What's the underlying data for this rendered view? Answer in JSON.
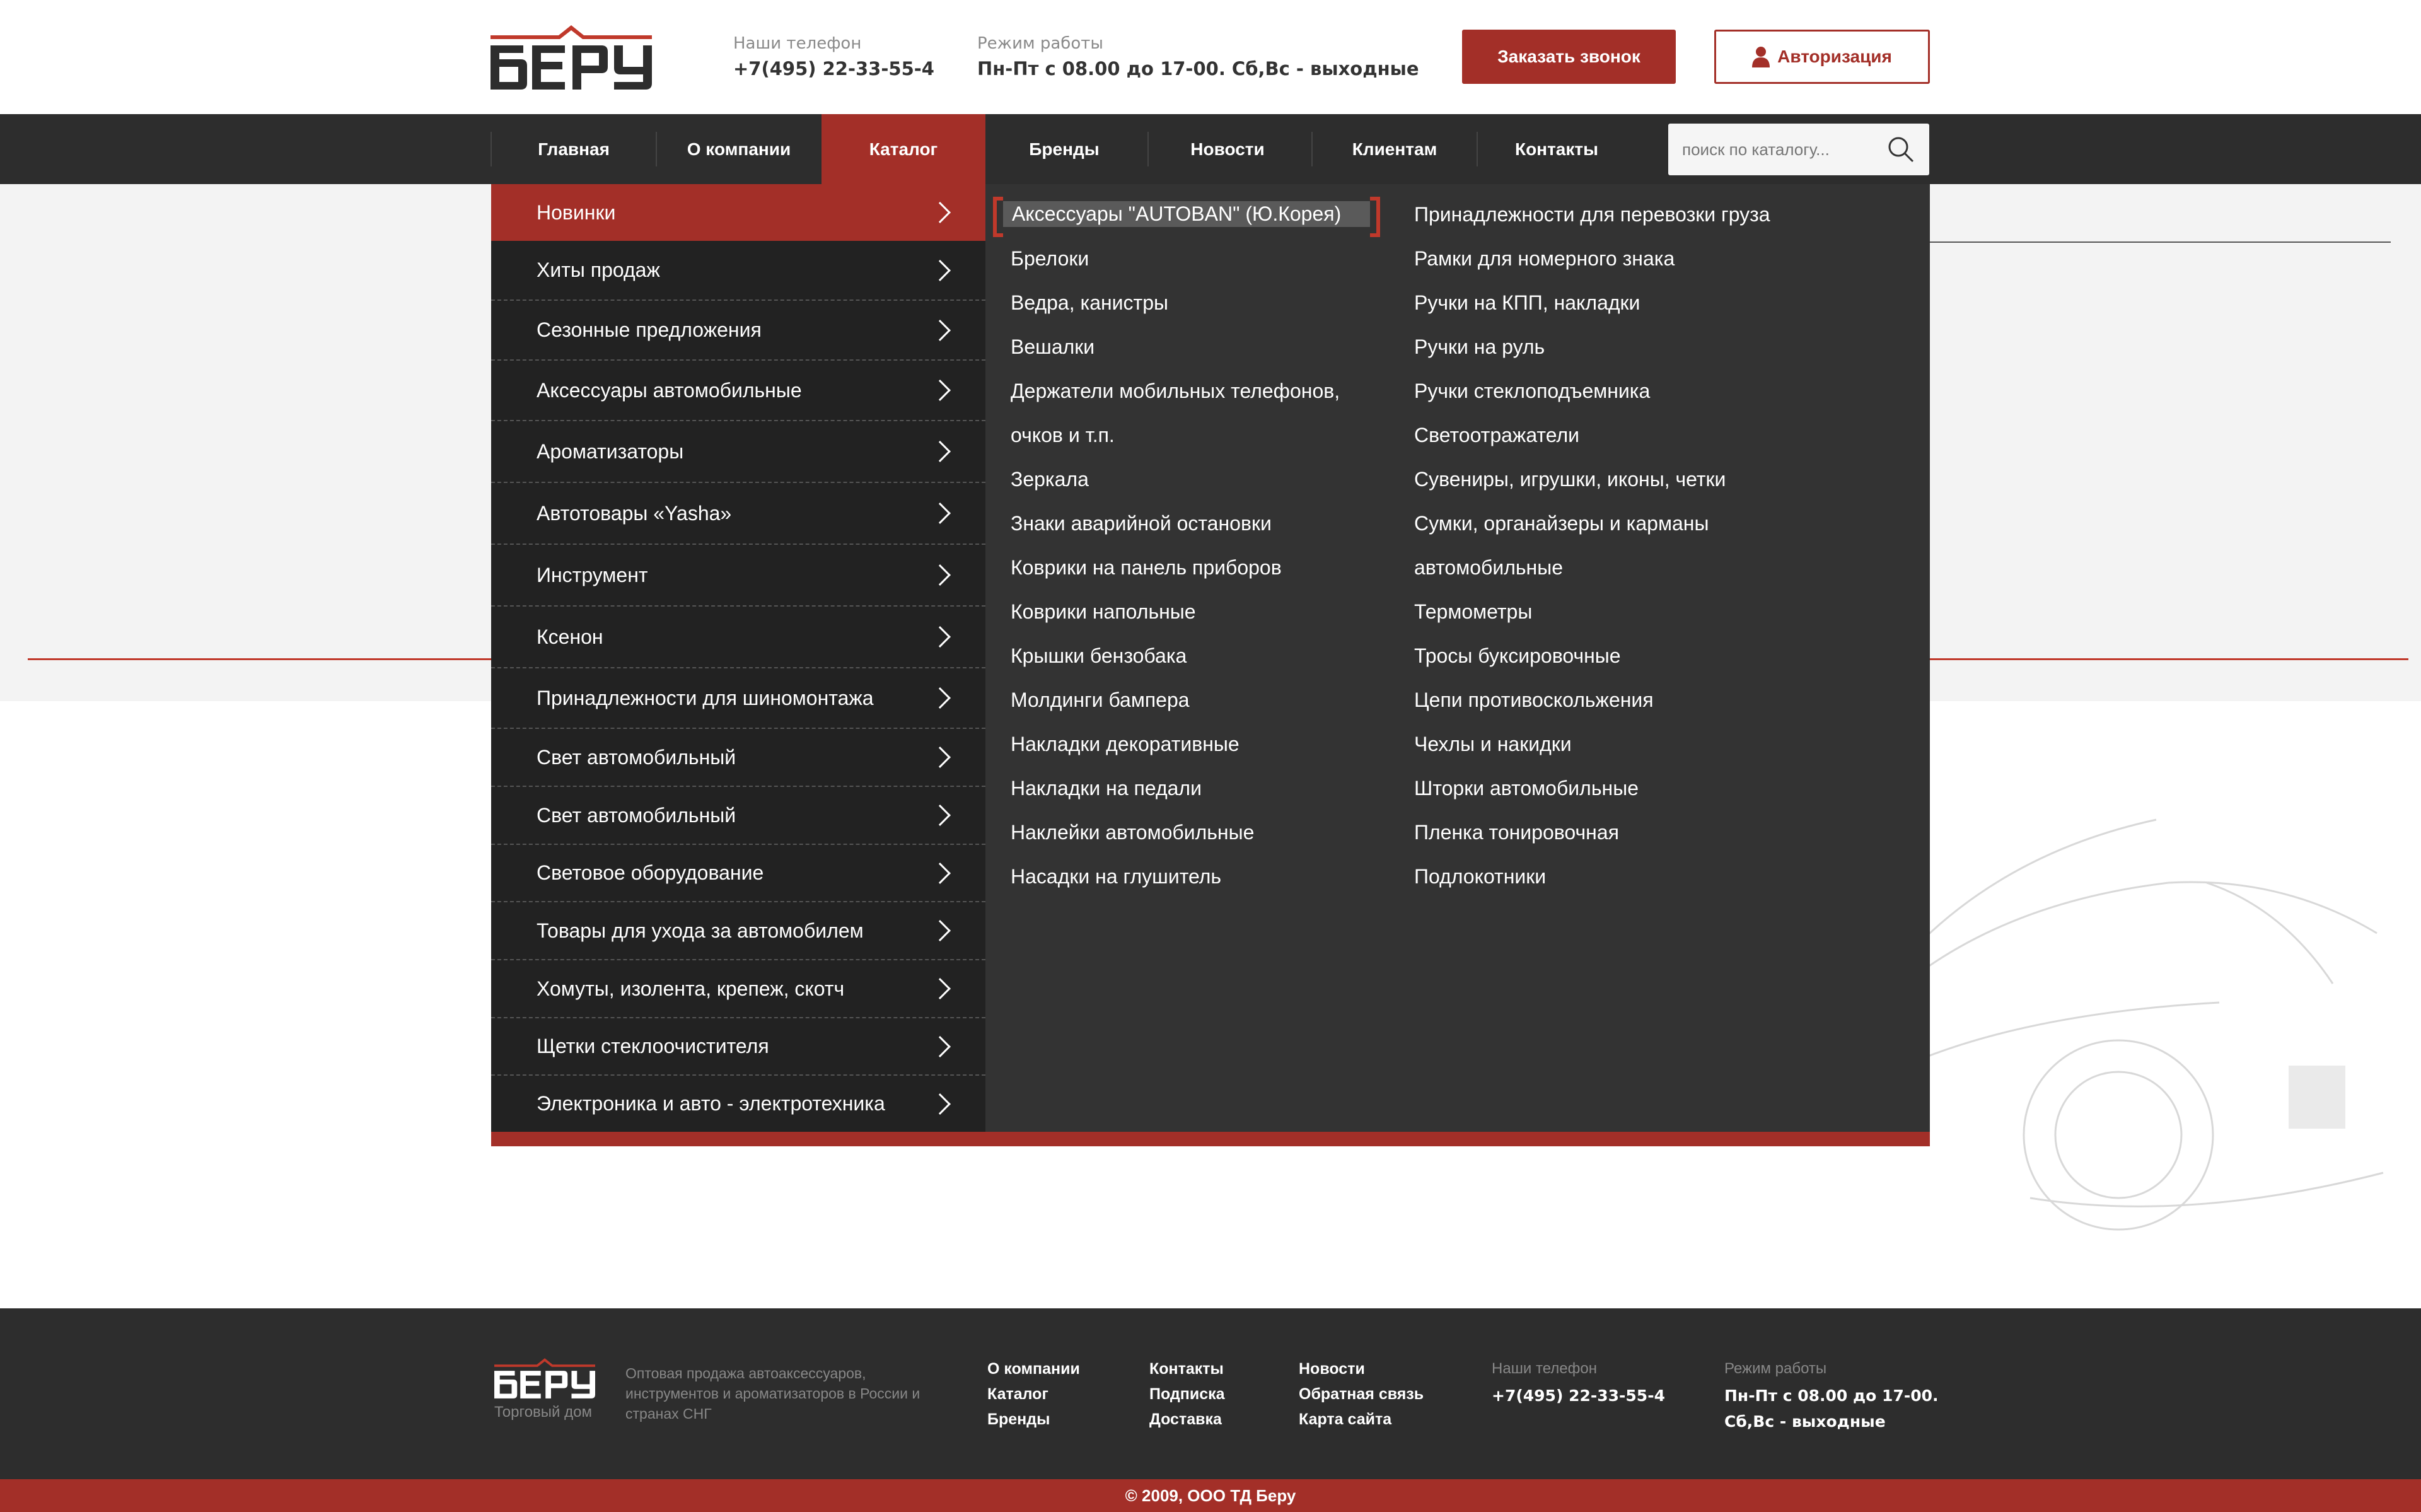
{
  "header": {
    "logo_alt": "Беру",
    "phone_label": "Наши телефон",
    "phone_value": "+7(495) 22-33-55-4",
    "hours_label": "Режим работы",
    "hours_value": "Пн-Пт с 08.00 до 17-00. Сб,Вс - выходные",
    "call_button": "Заказать звонок",
    "auth_button": "Авторизация"
  },
  "nav": {
    "items": [
      "Главная",
      "О компании",
      "Каталог",
      "Бренды",
      "Новости",
      "Клиентам",
      "Контакты"
    ],
    "active": "Каталог",
    "search_placeholder": "поиск по каталогу..."
  },
  "catalog": {
    "categories": [
      "Новинки",
      "Хиты продаж",
      "Сезонные предложения",
      "Аксессуары автомобильные",
      "Ароматизаторы",
      "Автотовары «Yasha»",
      "Инструмент",
      "Ксенон",
      "Принадлежности для шиномонтажа",
      "Свет автомобильный",
      "Свет автомобильный",
      "Световое оборудование",
      "Товары для ухода за автомобилем",
      "Хомуты, изолента, крепеж, скотч",
      "Щетки стеклоочистителя",
      "Электроника и авто - электротехника"
    ],
    "active_category": "Новинки",
    "sub_col1": [
      "Аксессуары \"AUTOBAN\" (Ю.Корея)",
      "Брелоки",
      "Ведра, канистры",
      "Вешалки",
      "Держатели мобильных телефонов,",
      "очков и т.п.",
      "Зеркала",
      "Знаки аварийной остановки",
      "Коврики на панель приборов",
      "Коврики напольные",
      "Крышки бензобака",
      "Молдинги бампера",
      "Накладки декоративные",
      "Накладки на педали",
      "Наклейки автомобильные",
      "Насадки на глушитель"
    ],
    "sub_col2": [
      "Принадлежности для перевозки груза",
      "Рамки для номерного знака",
      "Ручки на КПП, накладки",
      "Ручки на руль",
      "Ручки стеклоподъемника",
      "Светоотражатели",
      "Сувениры, игрушки, иконы, четки",
      "Сумки, органайзеры и карманы",
      "автомобильные",
      "Термометры",
      "Тросы буксировочные",
      "Цепи противоскольжения",
      "Чехлы и накидки",
      "Шторки автомобильные",
      "Пленка тонировочная",
      "Подлокотники"
    ]
  },
  "footer": {
    "logo_caption": "Торговый дом",
    "description": "Оптовая продажа автоаксессуаров, инструментов и ароматизаторов в России и странах СНГ",
    "col1": [
      "О компании",
      "Каталог",
      "Бренды"
    ],
    "col2": [
      "Контакты",
      "Подписка",
      "Доставка"
    ],
    "col3": [
      "Новости",
      "Обратная связь",
      "Карта сайта"
    ],
    "phone_label": "Наши телефон",
    "phone_value": "+7(495) 22-33-55-4",
    "hours_label": "Режим работы",
    "hours_line1": "Пн-Пт с 08.00 до 17-00.",
    "hours_line2": "Сб,Вс - выходные",
    "copyright": "© 2009, ООО ТД Беру"
  },
  "colors": {
    "brand_red": "#a32f28",
    "nav_dark": "#2d2d2d",
    "menu_dark": "#222222",
    "submenu_dark": "#333333"
  }
}
